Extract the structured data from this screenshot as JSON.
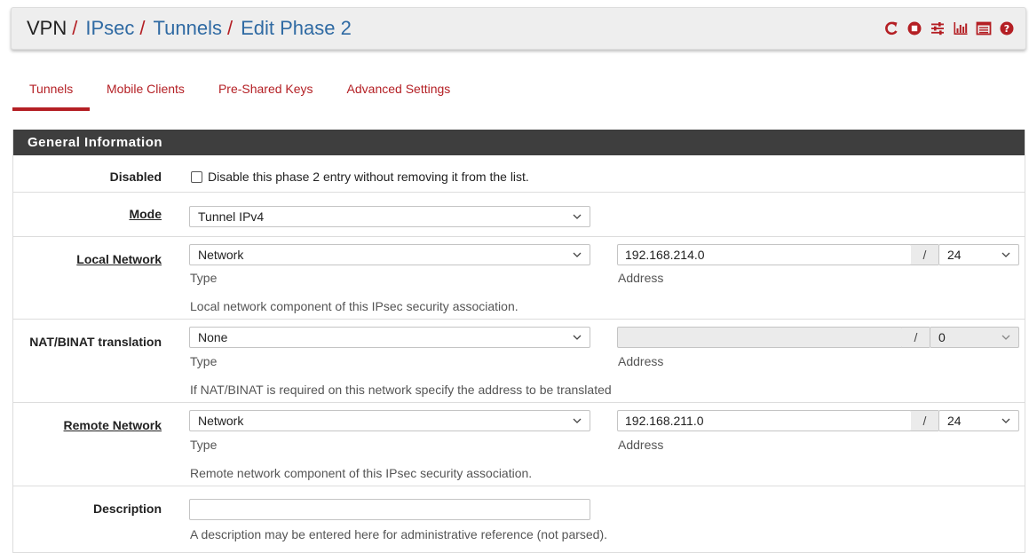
{
  "breadcrumb": {
    "root": "VPN",
    "items": [
      "IPsec",
      "Tunnels",
      "Edit Phase 2"
    ]
  },
  "header_icons": [
    "restart-icon",
    "stop-circle-icon",
    "sliders-icon",
    "bar-chart-icon",
    "log-list-icon",
    "help-icon"
  ],
  "tabs": [
    {
      "label": "Tunnels",
      "active": true
    },
    {
      "label": "Mobile Clients",
      "active": false
    },
    {
      "label": "Pre-Shared Keys",
      "active": false
    },
    {
      "label": "Advanced Settings",
      "active": false
    }
  ],
  "panel": {
    "heading": "General Information",
    "disabled": {
      "label": "Disabled",
      "checkbox_text": "Disable this phase 2 entry without removing it from the list.",
      "checked": false
    },
    "mode": {
      "label": "Mode",
      "value": "Tunnel IPv4"
    },
    "local_network": {
      "label": "Local Network",
      "type_value": "Network",
      "type_caption": "Type",
      "address_value": "192.168.214.0",
      "address_caption": "Address",
      "separator": "/",
      "mask_value": "24",
      "help": "Local network component of this IPsec security association."
    },
    "nat": {
      "label": "NAT/BINAT translation",
      "type_value": "None",
      "type_caption": "Type",
      "address_value": "",
      "address_caption": "Address",
      "separator": "/",
      "mask_value": "0",
      "help": "If NAT/BINAT is required on this network specify the address to be translated"
    },
    "remote_network": {
      "label": "Remote Network",
      "type_value": "Network",
      "type_caption": "Type",
      "address_value": "192.168.211.0",
      "address_caption": "Address",
      "separator": "/",
      "mask_value": "24",
      "help": "Remote network component of this IPsec security association."
    },
    "description": {
      "label": "Description",
      "value": "",
      "help": "A description may be entered here for administrative reference (not parsed)."
    }
  },
  "colors": {
    "accent": "#b41f24",
    "link": "#2f6aa3",
    "panel_heading_bg": "#3e3e3e"
  }
}
